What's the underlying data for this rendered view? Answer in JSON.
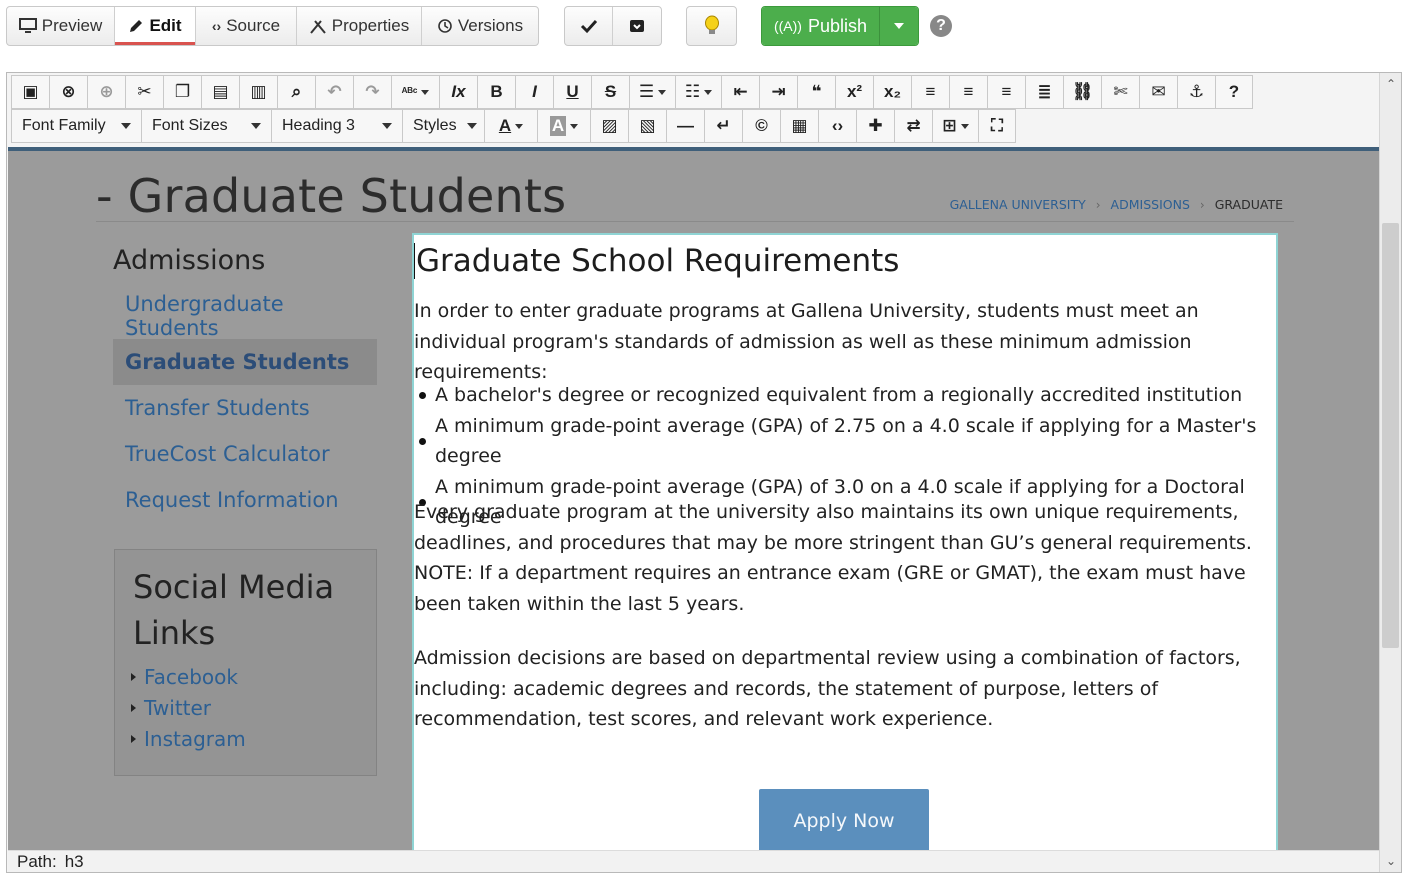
{
  "topbar": {
    "tabs": [
      {
        "label": "Preview",
        "icon": "monitor-icon"
      },
      {
        "label": "Edit",
        "icon": "pencil-icon",
        "active": true
      },
      {
        "label": "Source",
        "icon": "code-icon"
      },
      {
        "label": "Properties",
        "icon": "tools-icon"
      },
      {
        "label": "Versions",
        "icon": "history-icon"
      }
    ],
    "actions": [
      {
        "icon": "checkmark-icon"
      },
      {
        "icon": "archive-icon"
      }
    ],
    "tip_icon": "lightbulb-icon",
    "publish_label": "Publish",
    "publish_icon": "broadcast-icon",
    "help_symbol": "?",
    "colors": {
      "publish": "#4cae4c",
      "active_tab_underline": "#d9534f"
    }
  },
  "toolbar": {
    "row1_icons": [
      "save-icon",
      "close-circle-icon",
      "globe-icon",
      "cut-icon",
      "copy-icon",
      "paste-icon",
      "paste-text-icon",
      "find-icon",
      "undo-icon",
      "redo-icon",
      "spellcheck-icon",
      "clear-format-icon",
      "bold-icon",
      "italic-icon",
      "underline-icon",
      "strikethrough-icon",
      "bullet-list-icon",
      "numbered-list-icon",
      "outdent-icon",
      "indent-icon",
      "blockquote-icon",
      "superscript-icon",
      "subscript-icon",
      "align-left-icon",
      "align-center-icon",
      "align-right-icon",
      "align-justify-icon",
      "link-icon",
      "unlink-icon",
      "mail-icon",
      "anchor-icon",
      "help-circle-icon"
    ],
    "font_family_label": "Font Family",
    "font_sizes_label": "Font Sizes",
    "heading_label": "Heading 3",
    "styles_label": "Styles",
    "row2_icons": [
      "text-color-icon",
      "background-color-icon",
      "image-icon",
      "media-icon",
      "horizontal-rule-icon",
      "line-break-icon",
      "copyright-icon",
      "template-icon",
      "code-view-icon",
      "plugin-icon",
      "swap-icon",
      "table-icon",
      "fullscreen-icon"
    ]
  },
  "page": {
    "title": "- Graduate Students",
    "breadcrumb": {
      "items": [
        "GALLENA UNIVERSITY",
        "ADMISSIONS"
      ],
      "current": "GRADUATE",
      "separator": "›"
    }
  },
  "sidebar": {
    "heading": "Admissions",
    "items": [
      {
        "label": "Undergraduate Students"
      },
      {
        "label": "Graduate Students",
        "active": true
      },
      {
        "label": "Transfer Students"
      },
      {
        "label": "TrueCost Calculator"
      },
      {
        "label": "Request Information"
      }
    ],
    "social": {
      "title": "Social Media Links",
      "links": [
        "Facebook",
        "Twitter",
        "Instagram"
      ]
    }
  },
  "main": {
    "heading": "Graduate School Requirements",
    "intro": "In order to enter graduate programs at Gallena University, students must meet an individual program's standards of admission as well as these minimum admission requirements:",
    "bullets": [
      "A bachelor's degree or recognized equivalent from a regionally accredited institution",
      "A minimum grade-point average (GPA) of 2.75 on a 4.0 scale if applying for a Master's degree",
      "A minimum grade-point average (GPA) of 3.0 on a 4.0 scale if applying for a Doctoral degree"
    ],
    "para2": "Every graduate program at the university also maintains its own unique requirements, deadlines, and procedures that may be more stringent than GU’s general requirements. NOTE: If a department requires an entrance exam (GRE or GMAT), the exam must have been taken within the last 5 years.",
    "para3": "Admission decisions are based on departmental review using a combination of factors, including: academic degrees and records, the statement of purpose, letters of recommendation, test scores, and relevant work experience.",
    "apply_label": "Apply Now",
    "colors": {
      "apply_button": "#5b8fbd",
      "link": "#2c5f93",
      "content_background": "#9b9b9b"
    }
  },
  "status": {
    "path_label": "Path:",
    "path_value": "h3"
  }
}
